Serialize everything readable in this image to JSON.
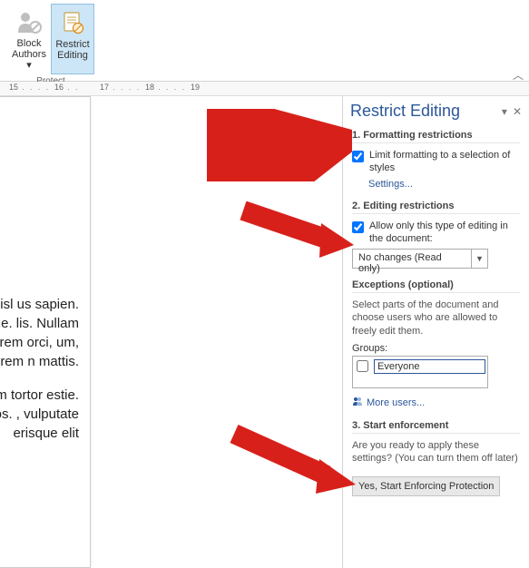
{
  "ribbon": {
    "group_label": "Protect",
    "block_authors": "Block Authors",
    "restrict_editing": "Restrict Editing"
  },
  "ruler": {
    "marks": [
      "15",
      "16",
      "17",
      "18",
      "19"
    ]
  },
  "document": {
    "para1": "aoreet nisl us sapien. lentesque. lis. Nullam ermentum. orem orci, um, lorem n mattis.",
    "para2": "ornare leo dum tortor estie. Nam eros eros. , vulputate erisque elit"
  },
  "pane": {
    "title": "Restrict Editing",
    "section1": {
      "heading": "1. Formatting restrictions",
      "checkbox_label": "Limit formatting to a selection of styles",
      "settings_link": "Settings..."
    },
    "section2": {
      "heading": "2. Editing restrictions",
      "checkbox_label": "Allow only this type of editing in the document:",
      "select_value": "No changes (Read only)"
    },
    "exceptions": {
      "heading": "Exceptions (optional)",
      "desc": "Select parts of the document and choose users who are allowed to freely edit them.",
      "groups_label": "Groups:",
      "everyone": "Everyone",
      "more_users": "More users..."
    },
    "section3": {
      "heading": "3. Start enforcement",
      "desc": "Are you ready to apply these settings? (You can turn them off later)",
      "button": "Yes, Start Enforcing Protection"
    }
  }
}
